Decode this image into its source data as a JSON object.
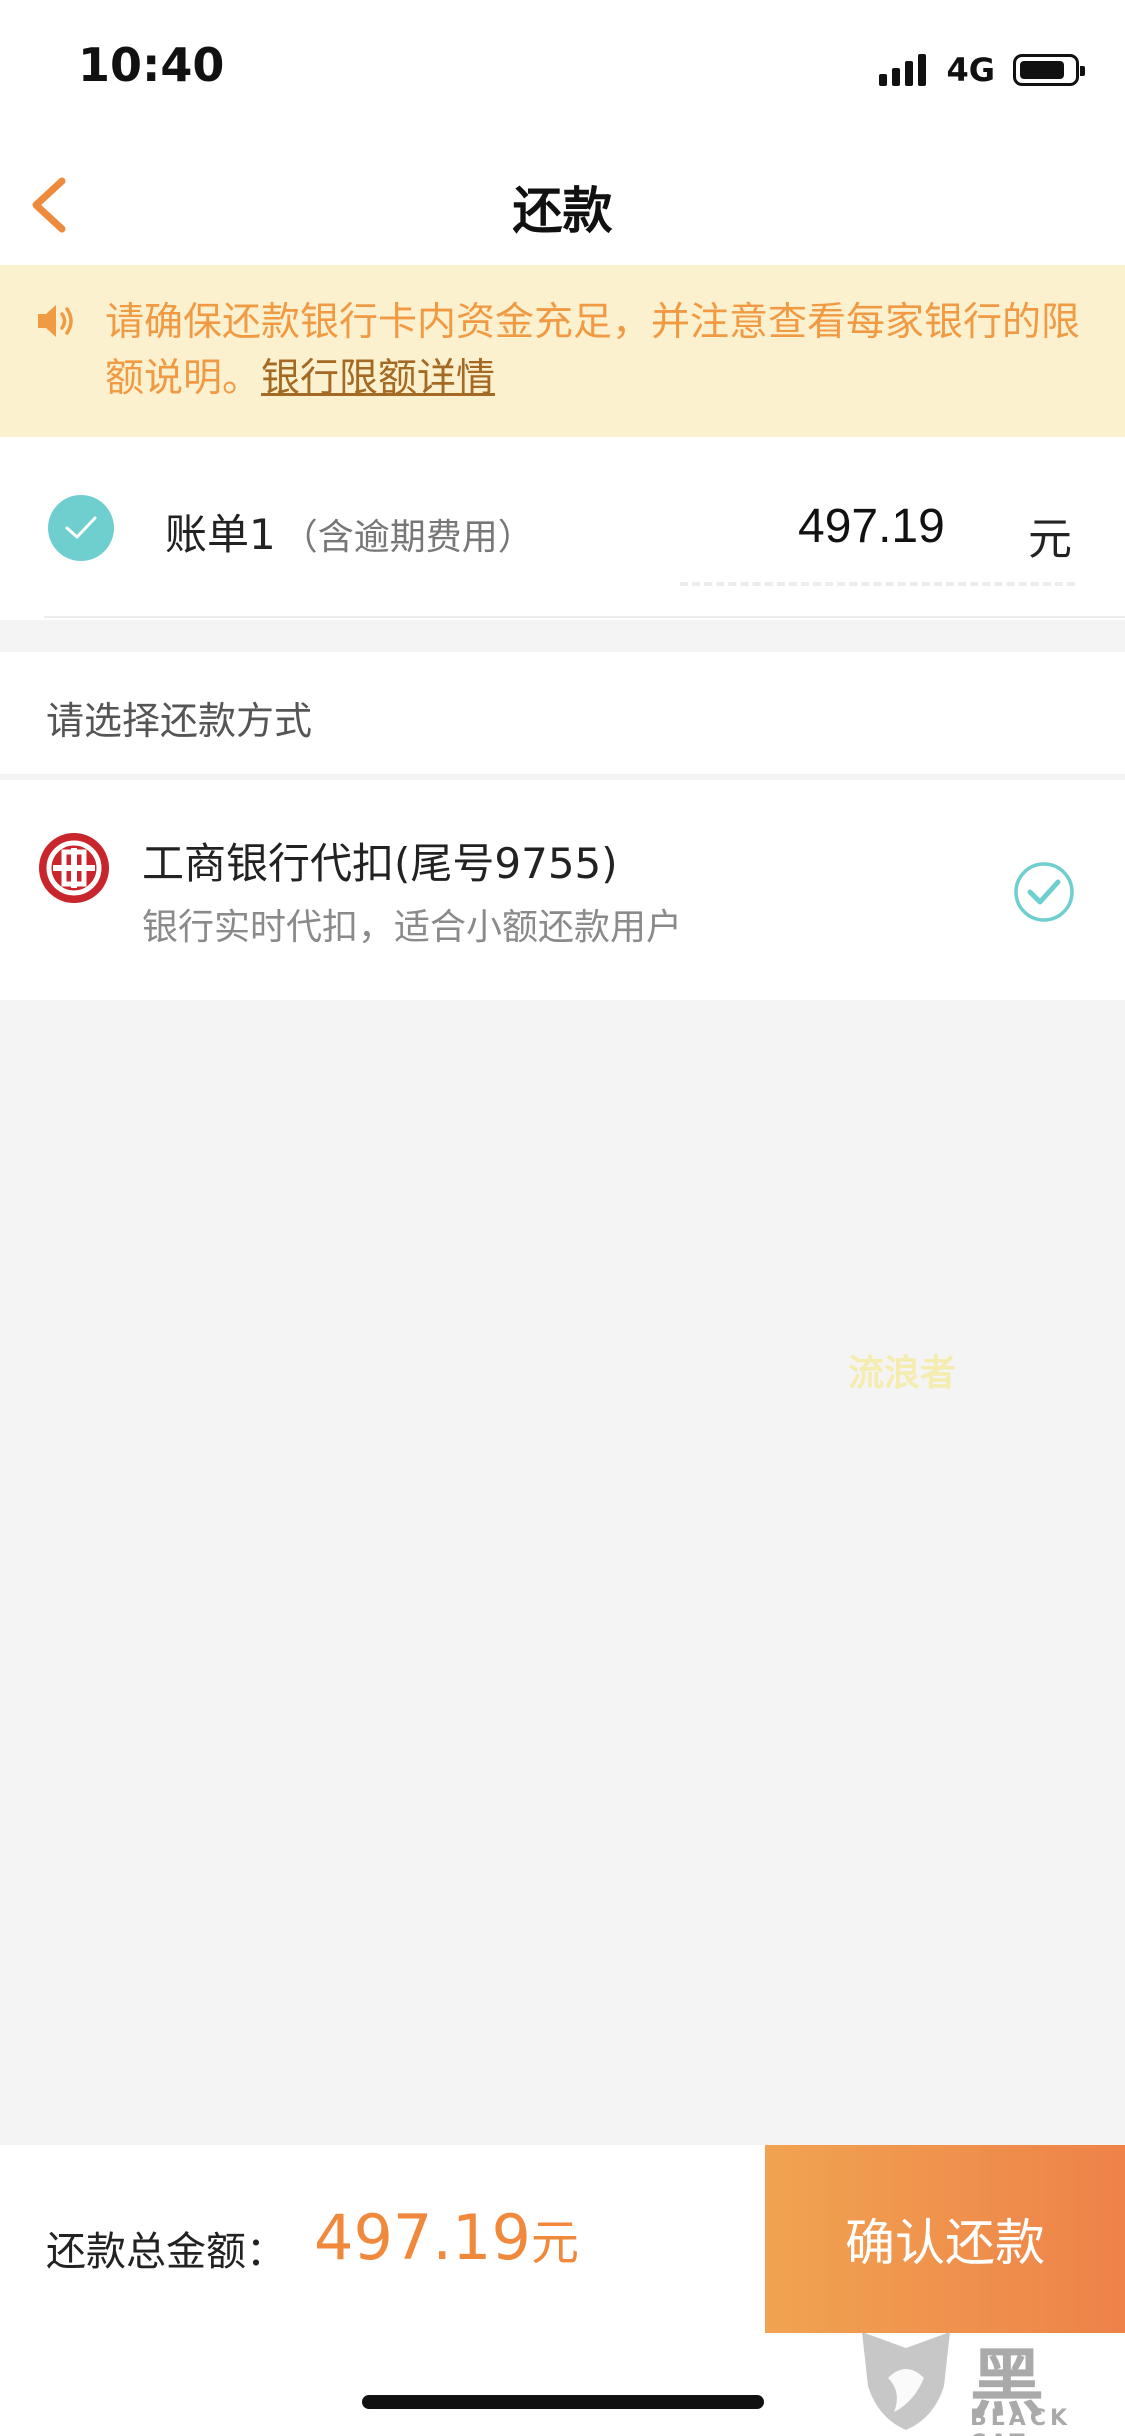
{
  "status_bar": {
    "time": "10:40",
    "network": "4G"
  },
  "nav": {
    "title": "还款"
  },
  "notice": {
    "text": "请确保还款银行卡内资金充足，并注意查看每家银行的限额说明。",
    "link_label": "银行限额详情"
  },
  "bill": {
    "label": "账单1",
    "note": "（含逾期费用）",
    "amount": "497.19",
    "unit": "元",
    "selected": true
  },
  "payment": {
    "section_label": "请选择还款方式",
    "method": {
      "name": "工商银行代扣(尾号9755)",
      "description": "银行实时代扣，适合小额还款用户",
      "selected": true
    }
  },
  "watermark": "流浪者",
  "footer": {
    "total_label": "还款总金额：",
    "total_amount": "497.19",
    "total_unit": "元",
    "confirm_label": "确认还款"
  },
  "corner_logo": {
    "title": "黑猫",
    "subtitle": "BLACK CAT"
  },
  "colors": {
    "accent": "#f0893c",
    "notice_bg": "#fcf1cf",
    "check_teal": "#6fcfcf",
    "bank_red": "#c8262c"
  }
}
